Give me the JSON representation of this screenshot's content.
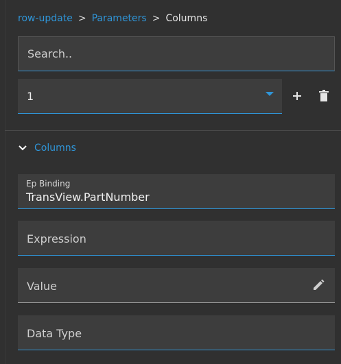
{
  "breadcrumb": {
    "items": [
      "row-update",
      "Parameters"
    ],
    "separator": ">",
    "current": "Columns"
  },
  "search": {
    "placeholder": "Search.."
  },
  "selector": {
    "value": "1"
  },
  "section": {
    "title": "Columns"
  },
  "fields": {
    "ep_binding": {
      "label": "Ep Binding",
      "value": "TransView.PartNumber"
    },
    "expression": {
      "label": "Expression"
    },
    "value": {
      "label": "Value"
    },
    "data_type": {
      "label": "Data Type"
    }
  },
  "colors": {
    "accent": "#2f95d8",
    "background": "#303030",
    "field": "#3d3d3d"
  },
  "icons": [
    "plus-icon",
    "trash-icon",
    "chevron-down-icon",
    "pencil-icon",
    "dropdown-arrow-icon"
  ]
}
